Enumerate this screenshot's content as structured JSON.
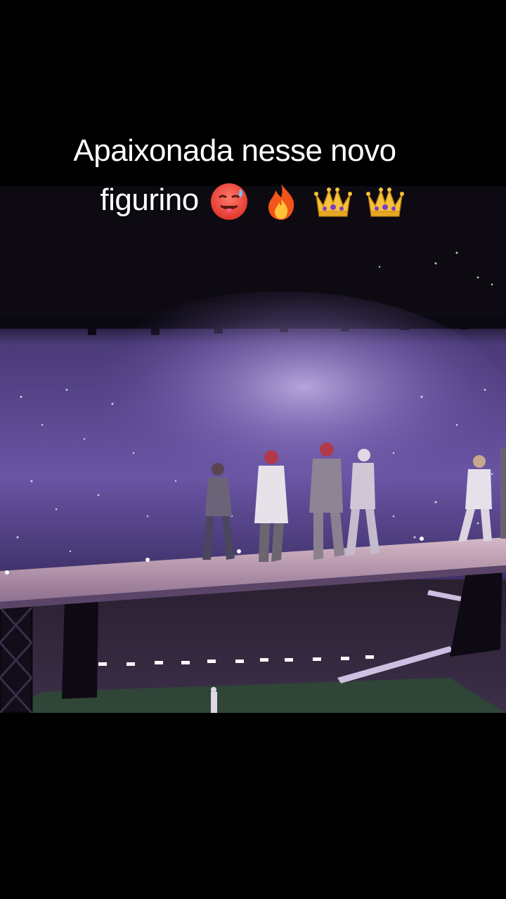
{
  "caption": {
    "line1": "Apaixonada nesse novo",
    "line2": "figurino"
  },
  "emojis": [
    "hot-face-emoji",
    "fire-emoji",
    "crown-emoji",
    "crown-emoji"
  ],
  "colors": {
    "background": "#000000",
    "caption_text": "#ffffff",
    "stage_purple": "#7a5fb8",
    "stage_floor": "#b99ab0"
  }
}
